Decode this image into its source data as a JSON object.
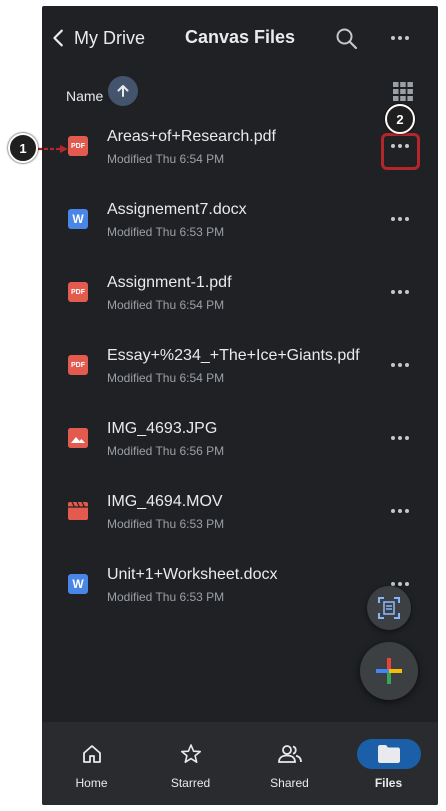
{
  "header": {
    "back_label": "My Drive",
    "title": "Canvas Files"
  },
  "sort": {
    "label": "Name"
  },
  "files": [
    {
      "name": "Areas+of+Research.pdf",
      "meta": "Modified Thu 6:54 PM",
      "type": "pdf-icon"
    },
    {
      "name": "Assignement7.docx",
      "meta": "Modified Thu 6:53 PM",
      "type": "word-doc-icon"
    },
    {
      "name": "Assignment-1.pdf",
      "meta": "Modified Thu 6:54 PM",
      "type": "pdf-icon"
    },
    {
      "name": "Essay+%234_+The+Ice+Giants.pdf",
      "meta": "Modified Thu 6:54 PM",
      "type": "pdf-icon"
    },
    {
      "name": "IMG_4693.JPG",
      "meta": "Modified Thu 6:56 PM",
      "type": "image-icon"
    },
    {
      "name": "IMG_4694.MOV",
      "meta": "Modified Thu 6:53 PM",
      "type": "video-icon"
    },
    {
      "name": "Unit+1+Worksheet.docx",
      "meta": "Modified Thu 6:53 PM",
      "type": "word-doc-icon"
    }
  ],
  "icon_text": {
    "pdf": "PDF",
    "doc": "W"
  },
  "callouts": {
    "one": "1",
    "two": "2"
  },
  "nav": [
    {
      "label": "Home",
      "icon": "home-icon"
    },
    {
      "label": "Starred",
      "icon": "star-icon"
    },
    {
      "label": "Shared",
      "icon": "shared-icon"
    },
    {
      "label": "Files",
      "icon": "folder-icon"
    }
  ],
  "colors": {
    "background": "#202124",
    "highlight": "#b3262b",
    "active_nav": "#1a5fa8",
    "pdf": "#e35a4f",
    "doc": "#4a86e8"
  }
}
